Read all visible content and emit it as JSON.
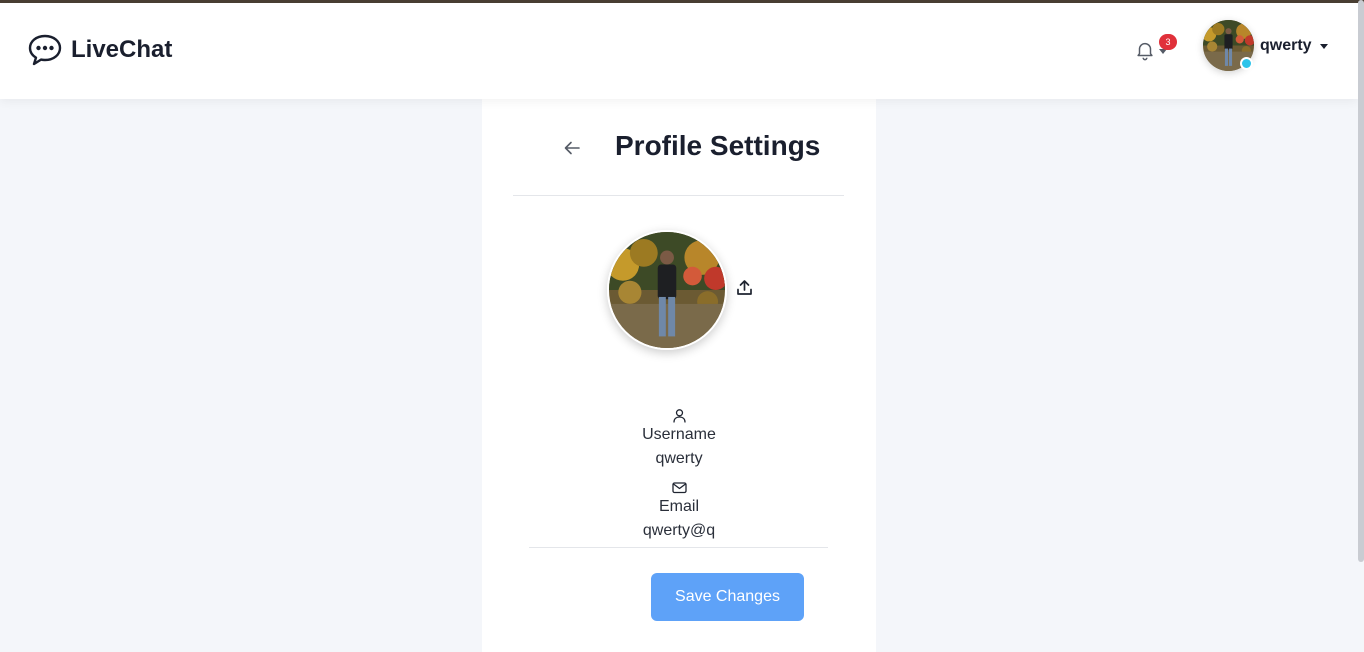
{
  "app": {
    "brand_name": "LiveChat",
    "brand_icon": "speech-bubble-icon"
  },
  "navbar": {
    "notifications": {
      "icon": "bell-icon",
      "count": "3"
    },
    "user": {
      "name": "qwerty",
      "status_color": "#2ec4ea"
    }
  },
  "page": {
    "title": "Profile Settings"
  },
  "profile": {
    "username": {
      "icon": "user-icon",
      "label": "Username",
      "value": "qwerty"
    },
    "email": {
      "icon": "mail-icon",
      "label": "Email",
      "value": "qwerty@q"
    },
    "save_label": "Save Changes"
  },
  "colors": {
    "accent": "#5ea2f8",
    "badge": "#e0303a",
    "background": "#f4f6fa"
  }
}
